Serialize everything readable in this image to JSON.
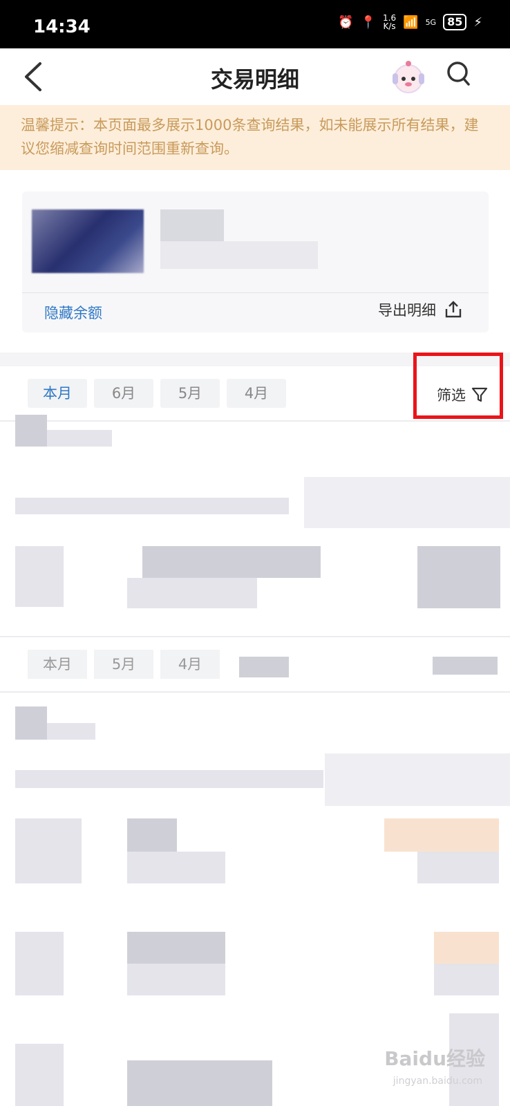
{
  "status_bar": {
    "time": "14:34",
    "net_speed_top": "1.6",
    "net_speed_bottom": "K/s",
    "signal": "5G",
    "battery": "85"
  },
  "nav": {
    "title": "交易明细"
  },
  "notice": {
    "text": "温馨提示：本页面最多展示1000条查询结果，如未能展示所有结果，建议您缩减查询时间范围重新查询。"
  },
  "account_card": {
    "hide_balance": "隐藏余额",
    "export": "导出明细"
  },
  "tabs": [
    {
      "label": "本月",
      "active": true
    },
    {
      "label": "6月",
      "active": false
    },
    {
      "label": "5月",
      "active": false
    },
    {
      "label": "4月",
      "active": false
    }
  ],
  "filter": {
    "label": "筛选"
  },
  "tabs_ghost": [
    {
      "label": "本月"
    },
    {
      "label": "5月"
    },
    {
      "label": "4月"
    }
  ],
  "watermark": {
    "text": "Baidu经验",
    "sub": "jingyan.baidu.com"
  },
  "colors": {
    "accent": "#2f78c4",
    "notice_bg": "#fdeedb",
    "notice_text": "#c89a5b",
    "highlight": "#e9141a"
  }
}
